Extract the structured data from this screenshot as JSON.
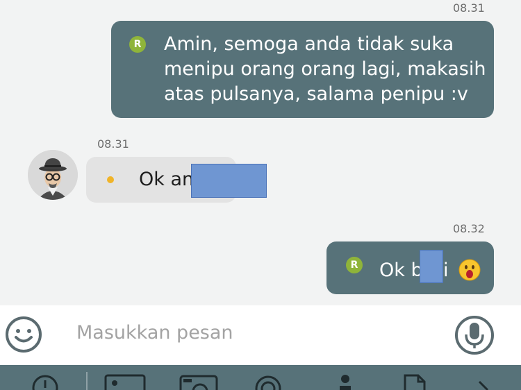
{
  "messages": [
    {
      "time": "08.31",
      "sender": "me",
      "badge": "R",
      "text": "Amin, semoga anda tidak suka\nmenipu orang orang lagi, makasih\natas pulsanya, salama penipu :v"
    },
    {
      "time": "08.31",
      "sender": "other",
      "text": "Ok an"
    },
    {
      "time": "08.32",
      "sender": "me",
      "badge": "R",
      "text_before": "Ok b",
      "text_after": "i"
    }
  ],
  "input": {
    "placeholder": "Masukkan pesan"
  },
  "icons": {
    "emoji": "smiley-face-icon",
    "mic": "microphone-icon",
    "toolbar": [
      "clock-icon",
      "gallery-icon",
      "camera-icon",
      "location-icon",
      "contact-icon",
      "file-icon",
      "chevron-right-icon"
    ]
  },
  "colors": {
    "bubble_out": "#577279",
    "bubble_in": "#e3e3e3",
    "badge": "#8fb43a",
    "toolbar": "#577279",
    "redaction": "#6f96d2"
  }
}
